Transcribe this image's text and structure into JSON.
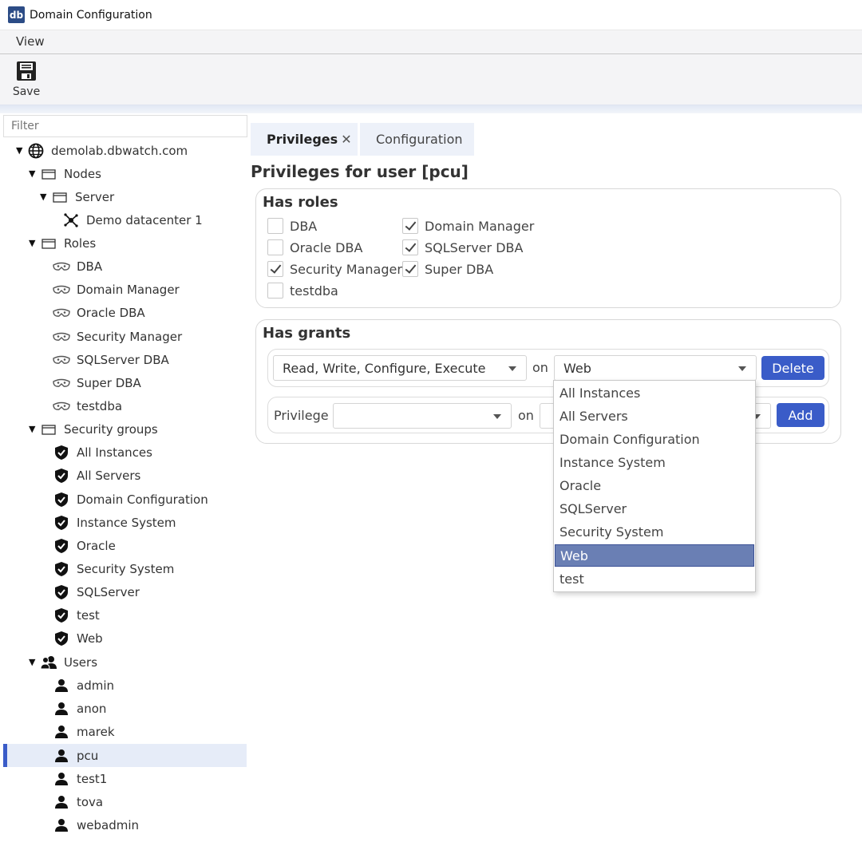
{
  "window": {
    "title": "Domain Configuration",
    "app_icon": "db"
  },
  "menu": {
    "view": "View"
  },
  "toolbar": {
    "save_label": "Save"
  },
  "sidebar": {
    "filter_placeholder": "Filter",
    "domain": "demolab.dbwatch.com",
    "nodes": {
      "label": "Nodes",
      "server": {
        "label": "Server",
        "datacenter": "Demo datacenter 1"
      }
    },
    "roles": {
      "label": "Roles",
      "items": [
        "DBA",
        "Domain Manager",
        "Oracle DBA",
        "Security Manager",
        "SQLServer DBA",
        "Super DBA",
        "testdba"
      ]
    },
    "security_groups": {
      "label": "Security groups",
      "items": [
        "All Instances",
        "All Servers",
        "Domain Configuration",
        "Instance System",
        "Oracle",
        "Security System",
        "SQLServer",
        "test",
        "Web"
      ]
    },
    "users": {
      "label": "Users",
      "items": [
        "admin",
        "anon",
        "marek",
        "pcu",
        "test1",
        "tova",
        "webadmin"
      ],
      "selected": "pcu"
    }
  },
  "tabs": [
    {
      "label": "Privileges",
      "close": "✕"
    },
    {
      "label": "Configuration"
    }
  ],
  "main": {
    "heading": "Privileges for user [pcu]",
    "has_roles": {
      "title": "Has roles",
      "items": [
        {
          "label": "DBA",
          "checked": false
        },
        {
          "label": "Oracle DBA",
          "checked": false
        },
        {
          "label": "Security Manager",
          "checked": true
        },
        {
          "label": "testdba",
          "checked": false
        },
        {
          "label": "Domain Manager",
          "checked": true
        },
        {
          "label": "SQLServer DBA",
          "checked": true
        },
        {
          "label": "Super DBA",
          "checked": true
        }
      ]
    },
    "has_grants": {
      "title": "Has grants",
      "grant": {
        "privilege": "Read, Write, Configure, Execute",
        "on": "on",
        "target": "Web",
        "delete_label": "Delete"
      },
      "new_grant": {
        "label": "Privilege",
        "privilege": "",
        "on": "on",
        "target": "",
        "add_label": "Add"
      }
    },
    "dropdown": {
      "options": [
        "All Instances",
        "All Servers",
        "Domain Configuration",
        "Instance System",
        "Oracle",
        "SQLServer",
        "Security System",
        "Web",
        "test"
      ],
      "highlighted": "Web"
    }
  },
  "colors": {
    "accent": "#3a5cc8",
    "highlight": "#6a7fb4",
    "selected_row": "#e6ecf8"
  }
}
